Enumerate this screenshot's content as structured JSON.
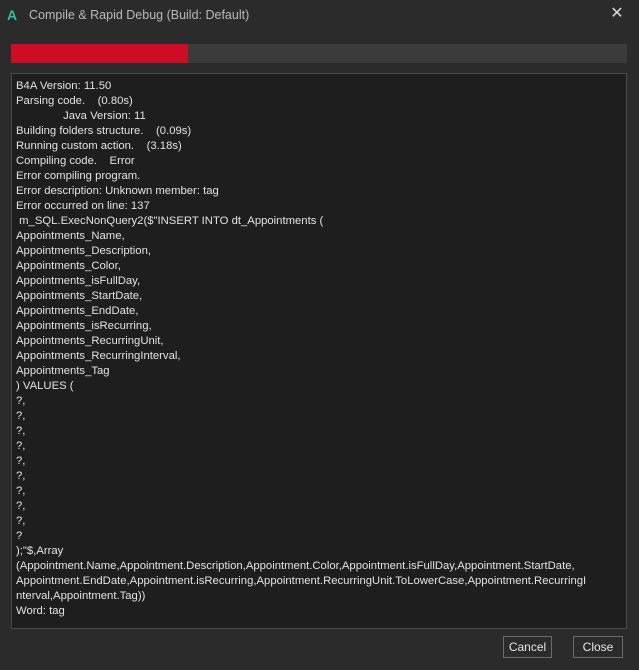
{
  "window": {
    "title": "Compile & Rapid Debug (Build: Default)",
    "app_icon_glyph": "A",
    "close_glyph": "✕"
  },
  "progress": {
    "fraction": 0.287,
    "color": "#cf0c25"
  },
  "log": {
    "lines": [
      "B4A Version: 11.50",
      "Parsing code.    (0.80s)",
      "               Java Version: 11",
      "Building folders structure.    (0.09s)",
      "Running custom action.    (3.18s)",
      "Compiling code.    Error",
      "Error compiling program.",
      "Error description: Unknown member: tag",
      "Error occurred on line: 137",
      " m_SQL.ExecNonQuery2($\"INSERT INTO dt_Appointments (",
      "Appointments_Name,",
      "Appointments_Description,",
      "Appointments_Color,",
      "Appointments_isFullDay,",
      "Appointments_StartDate,",
      "Appointments_EndDate,",
      "Appointments_isRecurring,",
      "Appointments_RecurringUnit,",
      "Appointments_RecurringInterval,",
      "Appointments_Tag",
      ") VALUES (",
      "?,",
      "?,",
      "?,",
      "?,",
      "?,",
      "?,",
      "?,",
      "?,",
      "?,",
      "?",
      ");\"$,Array",
      "(Appointment.Name,Appointment.Description,Appointment.Color,Appointment.isFullDay,Appointment.StartDate,",
      "Appointment.EndDate,Appointment.isRecurring,Appointment.RecurringUnit.ToLowerCase,Appointment.RecurringI",
      "nterval,Appointment.Tag))",
      "Word: tag"
    ]
  },
  "buttons": {
    "cancel_label": "Cancel",
    "close_label": "Close"
  }
}
